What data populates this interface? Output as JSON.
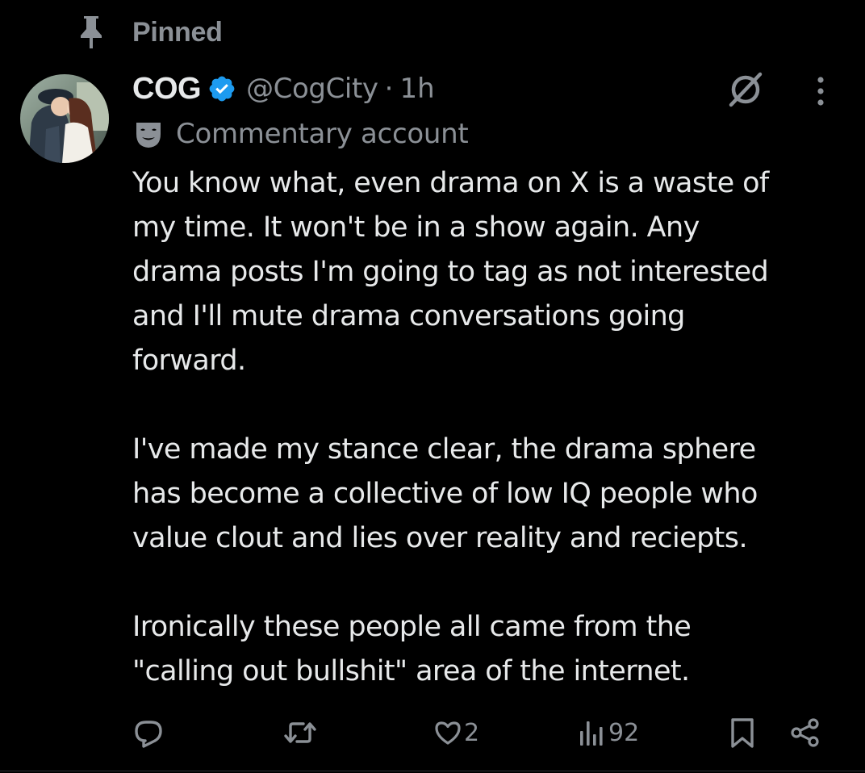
{
  "pinned": {
    "label": "Pinned",
    "icon": "pin-icon"
  },
  "author": {
    "display_name": "COG",
    "verified": true,
    "handle": "@CogCity",
    "separator": "·",
    "time": "1h",
    "account_label": "Commentary account",
    "label_icon": "theater-mask-icon"
  },
  "tweet": {
    "paragraphs": [
      "You know what, even drama on X is a waste of\nmy time. It won't be in a show again. Any\ndrama posts I'm going to tag as not interested\nand I'll mute drama conversations going\nforward.",
      "I've made my stance clear, the drama sphere\nhas become a collective of low IQ people who\nvalue clout and lies over reality and reciepts.",
      "Ironically these people all came from the\n\"calling out bullshit\" area of the internet."
    ]
  },
  "actions": {
    "reply": {
      "icon": "reply-icon"
    },
    "repost": {
      "icon": "repost-icon"
    },
    "like": {
      "icon": "heart-icon",
      "count": "2"
    },
    "views": {
      "icon": "views-icon",
      "count": "92"
    },
    "bookmark": {
      "icon": "bookmark-icon"
    },
    "share": {
      "icon": "share-icon"
    }
  },
  "colors": {
    "background": "#000000",
    "text_primary": "#e7e9ea",
    "text_secondary": "#8b9096",
    "verified_blue": "#1d9bf0"
  }
}
